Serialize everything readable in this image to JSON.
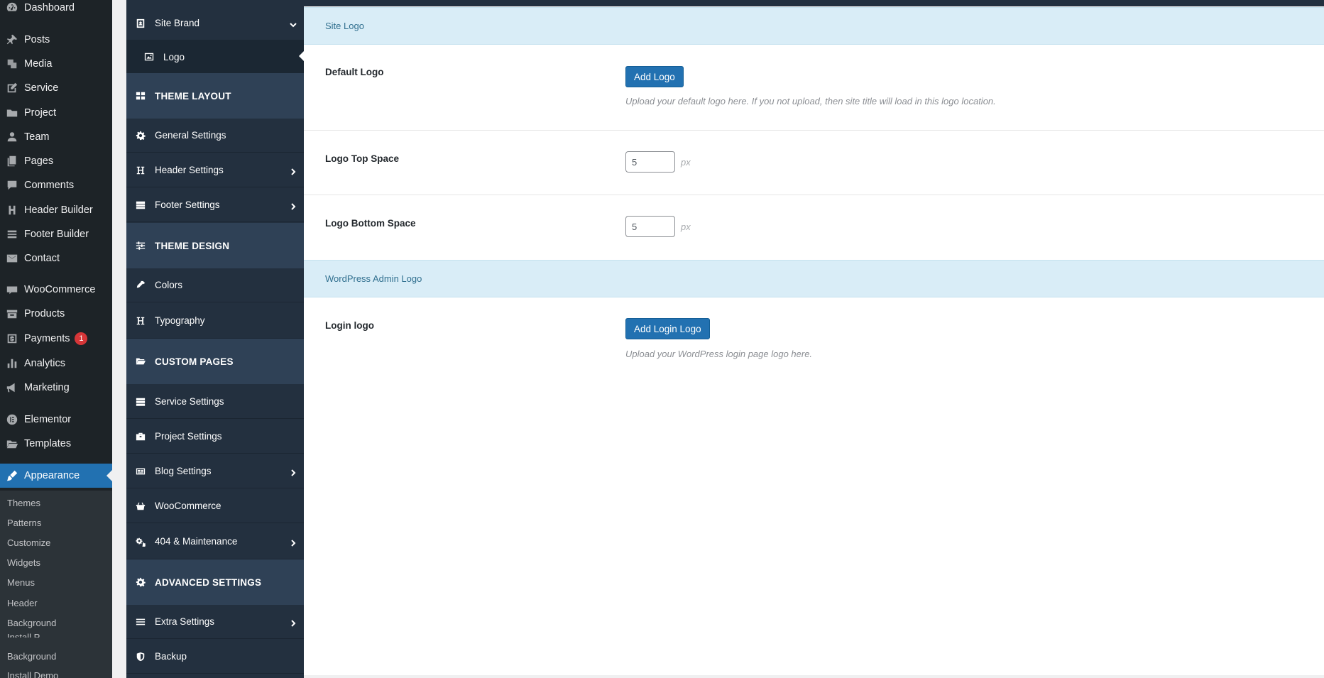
{
  "wp_menu": {
    "items": [
      {
        "label": "Dashboard",
        "icon": "dashboard-icon"
      },
      {
        "label": "Posts",
        "icon": "pin-icon"
      },
      {
        "label": "Media",
        "icon": "media-icon"
      },
      {
        "label": "Service",
        "icon": "edit-icon"
      },
      {
        "label": "Project",
        "icon": "folder-icon"
      },
      {
        "label": "Team",
        "icon": "user-icon"
      },
      {
        "label": "Pages",
        "icon": "pages-icon"
      },
      {
        "label": "Comments",
        "icon": "comment-icon"
      },
      {
        "label": "Header Builder",
        "icon": "h-icon"
      },
      {
        "label": "Footer Builder",
        "icon": "list-icon"
      },
      {
        "label": "Contact",
        "icon": "mail-icon"
      },
      {
        "label": "WooCommerce",
        "icon": "woo-icon"
      },
      {
        "label": "Products",
        "icon": "archive-icon"
      },
      {
        "label": "Payments",
        "icon": "dollar-icon",
        "badge": "1"
      },
      {
        "label": "Analytics",
        "icon": "chart-icon"
      },
      {
        "label": "Marketing",
        "icon": "megaphone-icon"
      },
      {
        "label": "Elementor",
        "icon": "elementor-icon"
      },
      {
        "label": "Templates",
        "icon": "folder-open-icon"
      },
      {
        "label": "Appearance",
        "icon": "brush-icon"
      }
    ],
    "submenu": [
      "Themes",
      "Patterns",
      "Customize",
      "Widgets",
      "Menus",
      "Header",
      "Background",
      "Install P...",
      "Background",
      "Install Demo"
    ]
  },
  "options_panel": {
    "site_brand": "Site Brand",
    "logo": "Logo",
    "theme_layout": "THEME LAYOUT",
    "general_settings": "General Settings",
    "header_settings": "Header Settings",
    "footer_settings": "Footer Settings",
    "theme_design": "THEME DESIGN",
    "colors": "Colors",
    "typography": "Typography",
    "custom_pages": "CUSTOM PAGES",
    "service_settings": "Service Settings",
    "project_settings": "Project Settings",
    "blog_settings": "Blog Settings",
    "woocommerce": "WooCommerce",
    "maintenance": "404 & Maintenance",
    "advanced_settings": "ADVANCED SETTINGS",
    "extra_settings": "Extra Settings",
    "backup": "Backup"
  },
  "main": {
    "site_logo_heading": "Site Logo",
    "default_logo_label": "Default Logo",
    "add_logo_button": "Add Logo",
    "default_logo_desc": "Upload your default logo here. If you not upload, then site title will load in this logo location.",
    "logo_top_space_label": "Logo Top Space",
    "logo_top_space_value": "5",
    "logo_bottom_space_label": "Logo Bottom Space",
    "logo_bottom_space_value": "5",
    "unit": "px",
    "admin_logo_heading": "WordPress Admin Logo",
    "login_logo_label": "Login logo",
    "add_login_logo_button": "Add Login Logo",
    "login_logo_desc": "Upload your WordPress login page logo here."
  }
}
